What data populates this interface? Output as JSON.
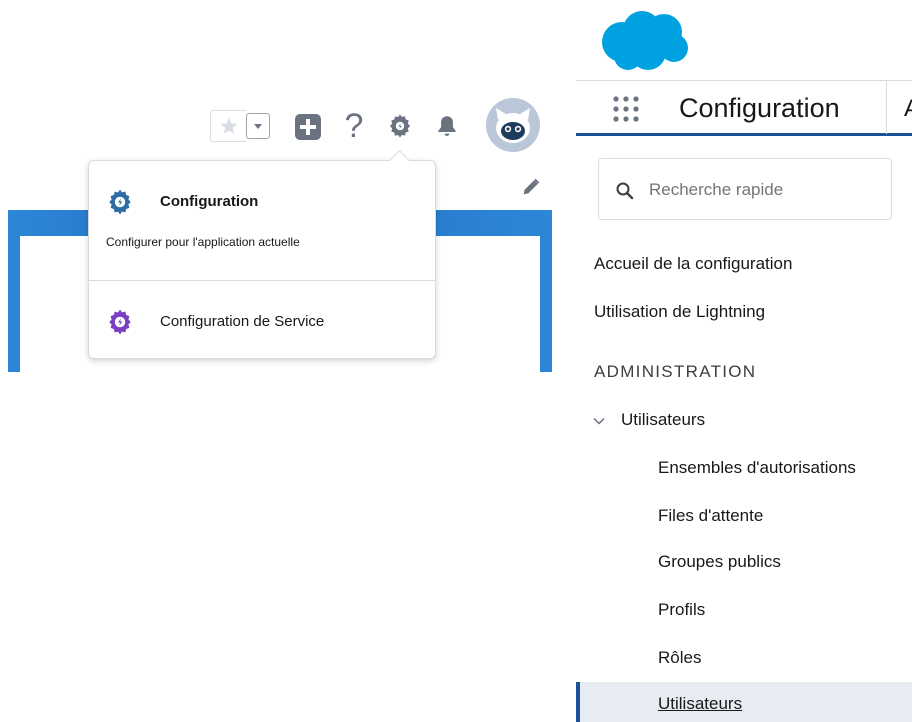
{
  "header": {
    "icons": [
      "star-icon",
      "chevron-down-icon",
      "add-icon",
      "help-icon",
      "gear-icon",
      "bell-icon",
      "avatar",
      "edit-icon"
    ],
    "help_glyph": "?"
  },
  "setup_menu": {
    "items": [
      {
        "icon": "setup-gear-icon",
        "title": "Configuration",
        "description": "Configurer pour l'application actuelle",
        "icon_color": "#2e6da4"
      },
      {
        "icon": "service-setup-gear-icon",
        "title": "Configuration de Service",
        "icon_color": "#7b3fc4"
      }
    ]
  },
  "setup_app": {
    "title": "Configuration",
    "tab_peek": "A",
    "search": {
      "placeholder": "Recherche rapide",
      "value": ""
    },
    "nav": {
      "home": "Accueil de la configuration",
      "lightning": "Utilisation de Lightning",
      "section": "ADMINISTRATION",
      "tree": {
        "label": "Utilisateurs",
        "expanded": true,
        "children": [
          "Ensembles d'autorisations",
          "Files d'attente",
          "Groupes publics",
          "Profils",
          "Rôles",
          "Utilisateurs"
        ],
        "selected": "Utilisateurs"
      }
    }
  },
  "colors": {
    "brand_blue": "#1b5297",
    "cloud_blue": "#00a1e0",
    "banner_blue": "#2a7fd4",
    "selected_bg": "#e6ecf2"
  }
}
